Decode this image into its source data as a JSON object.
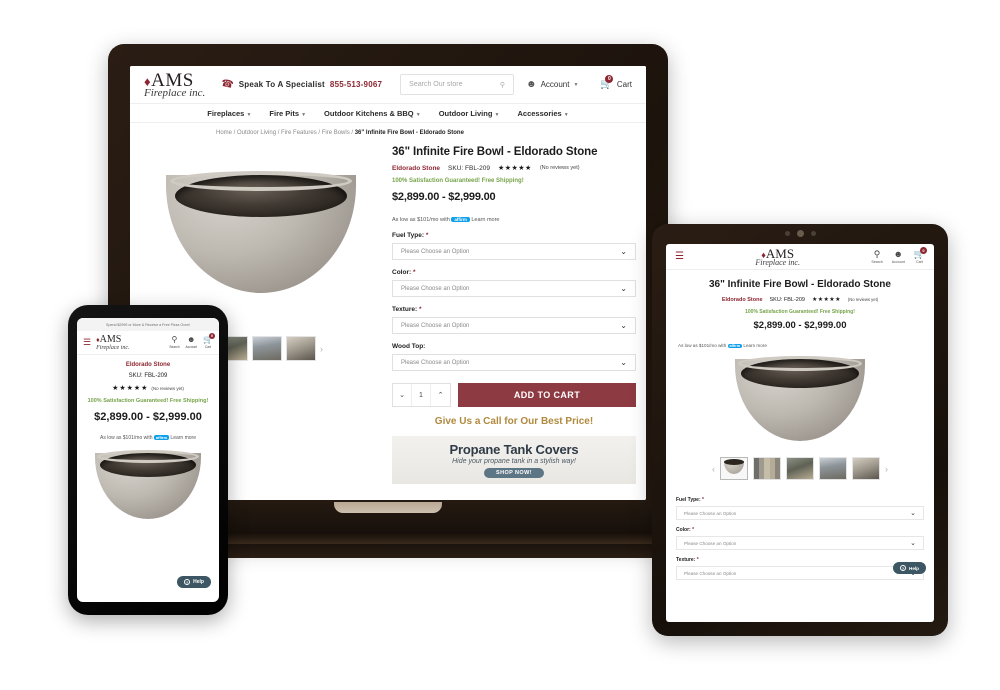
{
  "site": {
    "logo": {
      "main": "AMS",
      "sub": "Fireplace inc.",
      "flame_icon": "flame-icon"
    },
    "header": {
      "speak_label": "Speak To A Specialist",
      "phone": "855-513-9067",
      "phone_icon": "phone-icon",
      "search_placeholder": "Search Our store",
      "search_icon": "search-icon",
      "account_label": "Account",
      "account_icon": "account-icon",
      "cart_label": "Cart",
      "cart_icon": "cart-icon",
      "cart_count": "0"
    },
    "nav": [
      {
        "label": "Fireplaces"
      },
      {
        "label": "Fire Pits"
      },
      {
        "label": "Outdoor Kitchens & BBQ"
      },
      {
        "label": "Outdoor Living"
      },
      {
        "label": "Accessories"
      }
    ],
    "breadcrumb": {
      "items": [
        "Home",
        "Outdoor Living",
        "Fire Features",
        "Fire Bowls"
      ],
      "current": "36\" Infinite Fire Bowl - Eldorado Stone",
      "full": "Home / Outdoor Living / Fire Features / Fire Bowls / "
    },
    "product": {
      "title": "36\" Infinite Fire Bowl - Eldorado Stone",
      "brand": "Eldorado Stone",
      "sku": "SKU: FBL-209",
      "stars": "★★★★★",
      "reviews": "(No reviews yet)",
      "guarantee": "100% Satisfaction Guaranteed! Free Shipping!",
      "price": "$2,899.00 - $2,999.00",
      "affirm_prefix": "As low as $101/mo with",
      "affirm_brand": "affirm",
      "affirm_link": "Learn more",
      "options": [
        {
          "label": "Fuel Type:",
          "required": "*",
          "value": "Please Choose an Option"
        },
        {
          "label": "Color:",
          "required": "*",
          "value": "Please Choose an Option"
        },
        {
          "label": "Texture:",
          "required": "*",
          "value": "Please Choose an Option"
        },
        {
          "label": "Wood Top:",
          "required": "",
          "value": "Please Choose an Option"
        }
      ],
      "quantity": "1",
      "qty_down_icon": "chevron-down-icon",
      "qty_up_icon": "chevron-up-icon",
      "add_to_cart": "ADD TO CART",
      "call_line": "Give Us a Call for Our Best Price!"
    },
    "promo_banner": {
      "title": "Propane Tank Covers",
      "subtitle": "Hide your propane tank in a stylish way!",
      "button": "SHOP NOW!"
    },
    "gallery": {
      "prev_icon": "chevron-left-icon",
      "next_icon": "chevron-right-icon",
      "thumbs": [
        "bowl-product-thumb",
        "color-swatches-thumb",
        "patio-bowl-thumb",
        "lit-firebowl-thumb",
        "outdoor-scene-thumb"
      ]
    }
  },
  "phone": {
    "announcement": "Spend $2999 or More & Receive a Free Pizza Oven!",
    "menu_icon": "hamburger-menu-icon",
    "icons": [
      {
        "name": "search-icon",
        "label": "Search"
      },
      {
        "name": "account-icon",
        "label": "Account"
      },
      {
        "name": "cart-icon",
        "label": "Cart",
        "badge": "0"
      }
    ],
    "brand": "Eldorado Stone",
    "sku": "SKU: FBL-209",
    "stars": "★★★★★",
    "reviews": "(No reviews yet)",
    "guarantee": "100% Satisfaction Guaranteed! Free Shipping!",
    "price": "$2,899.00 - $2,999.00",
    "affirm_prefix": "As low as $101/mo with",
    "affirm_brand": "affirm",
    "affirm_link": "Learn more",
    "help_label": "Help",
    "help_icon": "question-circle-icon"
  },
  "tablet": {
    "menu_icon": "hamburger-menu-icon",
    "icons": [
      {
        "name": "search-icon",
        "label": "Search"
      },
      {
        "name": "account-icon",
        "label": "Account"
      },
      {
        "name": "cart-icon",
        "label": "Cart",
        "badge": "0"
      }
    ],
    "title": "36\" Infinite Fire Bowl - Eldorado Stone",
    "brand": "Eldorado Stone",
    "sku": "SKU: FBL-209",
    "stars": "★★★★★",
    "reviews": "(No reviews yet)",
    "guarantee": "100% Satisfaction Guaranteed! Free Shipping!",
    "price": "$2,899.00 - $2,999.00",
    "affirm_prefix": "As low as $101/mo with",
    "affirm_brand": "affirm",
    "affirm_link": "Learn more",
    "options": [
      {
        "label": "Fuel Type:",
        "required": "*",
        "value": "Please Choose an Option"
      },
      {
        "label": "Color:",
        "required": "*",
        "value": "Please Choose an Option"
      },
      {
        "label": "Texture:",
        "required": "*",
        "value": "Please Choose an Option"
      }
    ],
    "help_label": "Help",
    "help_icon": "question-circle-icon",
    "prev_icon": "chevron-left-icon",
    "next_icon": "chevron-right-icon"
  },
  "colors": {
    "brand_red": "#8d2631",
    "cart_button": "#8d3a42",
    "green_text": "#76a34a",
    "gold_text": "#b08a3e",
    "help_pill": "#3d5664",
    "affirm_blue": "#0fa0ea"
  }
}
